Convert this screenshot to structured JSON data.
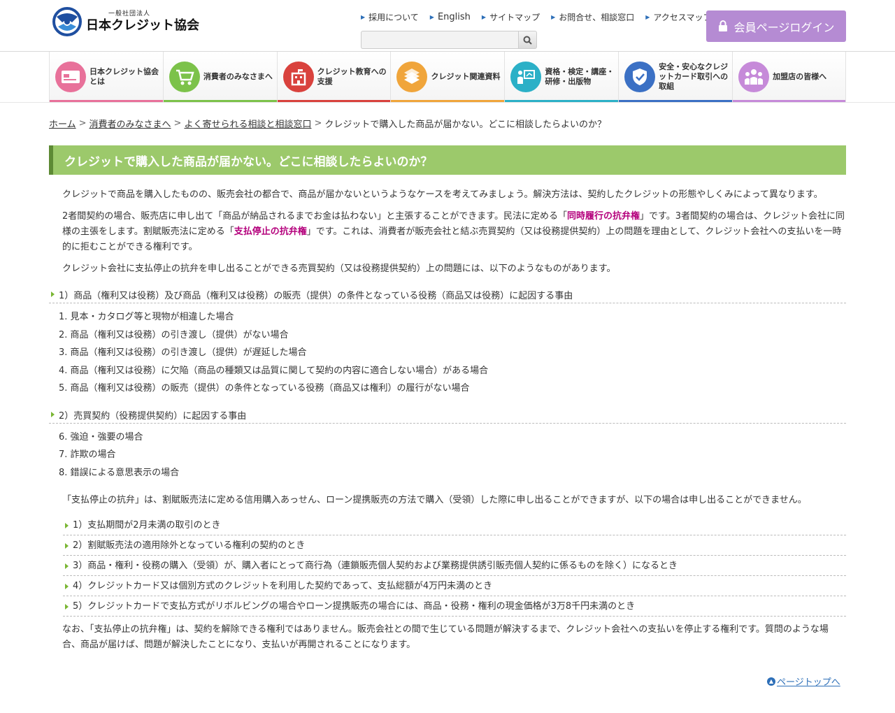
{
  "header": {
    "logo_small": "一般社団法人",
    "logo_main": "日本クレジット協会",
    "top_links": [
      "採用について",
      "English",
      "サイトマップ",
      "お問合せ、相談窓口",
      "アクセスマップ"
    ],
    "search_placeholder": "",
    "login_label": "会員ページログイン"
  },
  "nav": [
    {
      "label": "日本クレジット協会とは",
      "color": "#e8719a",
      "bar": "#e8719a",
      "icon": "card-icon"
    },
    {
      "label": "消費者のみなさまへ",
      "color": "#7cc24a",
      "bar": "#7cc24a",
      "icon": "cart-icon"
    },
    {
      "label": "クレジット教育への支援",
      "color": "#d9423d",
      "bar": "#d9423d",
      "icon": "school-icon"
    },
    {
      "label": "クレジット関連資料",
      "color": "#f0a53b",
      "bar": "#f0a53b",
      "icon": "books-icon"
    },
    {
      "label": "資格・検定・講座・研修・出版物",
      "color": "#2bb0c7",
      "bar": "#2bb0c7",
      "icon": "presentation-icon"
    },
    {
      "label": "安全・安心なクレジットカード取引への取組",
      "color": "#3b70c4",
      "bar": "#3b70c4",
      "icon": "shield-icon"
    },
    {
      "label": "加盟店の皆様へ",
      "color": "#c68ad9",
      "bar": "#c68ad9",
      "icon": "people-icon"
    }
  ],
  "breadcrumb": {
    "home": "ホーム",
    "level1": "消費者のみなさまへ",
    "level2": "よく寄せられる相談と相談窓口",
    "current": "クレジットで購入した商品が届かない。どこに相談したらよいのか？"
  },
  "title": "クレジットで購入した商品が届かない。どこに相談したらよいのか？",
  "paragraphs": {
    "p1": "クレジットで商品を購入したものの、販売会社の都合で、商品が届かないというようなケースを考えてみましょう。解決方法は、契約したクレジットの形態やしくみによって異なります。",
    "p2_a": "2者間契約の場合、販売店に申し出て「商品が納品されるまでお金は払わない」と主張することができます。民法に定める「",
    "p2_hl1": "同時履行の抗弁権",
    "p2_b": "」です。3者間契約の場合は、クレジット会社に同様の主張をします。割賦販売法に定める「",
    "p2_hl2": "支払停止の抗弁権",
    "p2_c": "」です。これは、消費者が販売会社と結ぶ売買契約（又は役務提供契約）上の問題を理由として、クレジット会社への支払いを一時的に拒むことができる権利です。",
    "p3": "クレジット会社に支払停止の抗弁を申し出ることができる売買契約（又は役務提供契約）上の問題には、以下のようなものがあります。",
    "p4": "「支払停止の抗弁」は、割賦販売法に定める信用購入あっせん、ローン提携販売の方法で購入（受領）した際に申し出ることができますが、以下の場合は申し出ることができません。",
    "p5": "なお、「支払停止の抗弁権」は、契約を解除できる権利ではありません。販売会社との間で生じている問題が解決するまで、クレジット会社への支払いを停止する権利です。質問のような場合、商品が届けば、問題が解決したことになり、支払いが再開されることになります。"
  },
  "section1": {
    "heading": "1）商品（権利又は役務）及び商品（権利又は役務）の販売（提供）の条件となっている役務（商品又は役務）に起因する事由",
    "items": [
      "1. 見本・カタログ等と現物が相違した場合",
      "2. 商品（権利又は役務）の引き渡し（提供）がない場合",
      "3. 商品（権利又は役務）の引き渡し（提供）が遅延した場合",
      "4. 商品（権利又は役務）に欠陥（商品の種類又は品質に関して契約の内容に適合しない場合）がある場合",
      "5. 商品（権利又は役務）の販売（提供）の条件となっている役務（商品又は権利）の履行がない場合"
    ]
  },
  "section2": {
    "heading": "2）売買契約（役務提供契約）に起因する事由",
    "items": [
      "6. 強迫・強要の場合",
      "7. 詐欺の場合",
      "8. 錯誤による意思表示の場合"
    ]
  },
  "exceptions": [
    "1）支払期間が2月未満の取引のとき",
    "2）割賦販売法の適用除外となっている権利の契約のとき",
    "3）商品・権利・役務の購入（受領）が、購入者にとって商行為（連鎖販売個人契約および業務提供誘引販売個人契約に係るものを除く）になるとき",
    "4）クレジットカード又は個別方式のクレジットを利用した契約であって、支払総額が4万円未満のとき",
    "5）クレジットカードで支払方式がリボルビングの場合やローン提携販売の場合には、商品・役務・権利の現金価格が3万8千円未満のとき"
  ],
  "page_top": "ページトップへ"
}
